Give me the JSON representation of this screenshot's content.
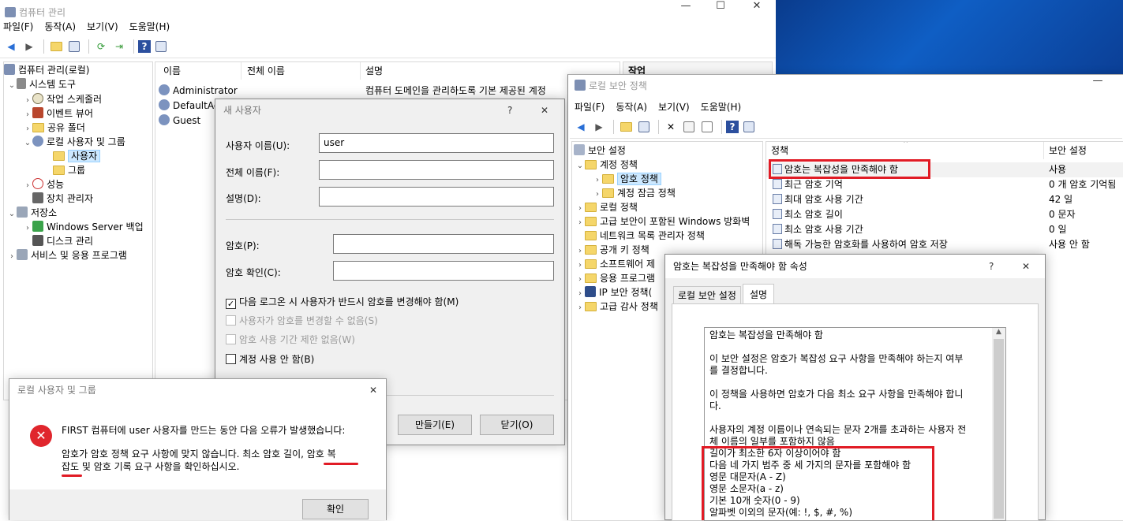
{
  "compmgmt": {
    "title": "컴퓨터 관리",
    "menu": [
      "파일(F)",
      "동작(A)",
      "보기(V)",
      "도움말(H)"
    ],
    "tree": [
      "컴퓨터 관리(로컬)",
      "시스템 도구",
      "작업 스케줄러",
      "이벤트 뷰어",
      "공유 폴더",
      "로컬 사용자 및 그룹",
      "사용자",
      "그룹",
      "성능",
      "장치 관리자",
      "저장소",
      "Windows Server 백업",
      "디스크 관리",
      "서비스 및 응용 프로그램"
    ],
    "columns": [
      "이름",
      "전체 이름",
      "설명"
    ],
    "users": [
      {
        "name": "Administrator",
        "desc": "컴퓨터 도메인을 관리하도록 기본 제공된 계정"
      },
      {
        "name": "DefaultAc",
        "desc": ""
      },
      {
        "name": "Guest",
        "desc": ""
      }
    ],
    "actions_header": "작업"
  },
  "newuser": {
    "title": "새 사용자",
    "help": "?",
    "close": "✕",
    "username_label": "사용자 이름(U):",
    "username_value": "user",
    "fullname_label": "전체 이름(F):",
    "fullname_value": "",
    "desc_label": "설명(D):",
    "desc_value": "",
    "password_label": "암호(P):",
    "confirm_label": "암호 확인(C):",
    "chk_must_change": "다음 로그온 시 사용자가 반드시 암호를 변경해야 함(M)",
    "chk_cannot_change": "사용자가 암호를 변경할 수 없음(S)",
    "chk_never_expires": "암호 사용 기간 제한 없음(W)",
    "chk_disabled": "계정 사용 안 함(B)",
    "create_button": "만들기(E)",
    "close_button": "닫기(O)"
  },
  "errordlg": {
    "title": "로컬 사용자 및 그룹",
    "close": "✕",
    "line1": "FIRST 컴퓨터에 user 사용자를 만드는 동안 다음 오류가 발생했습니다:",
    "line2": "암호가 암호 정책 요구 사항에 맞지 않습니다. 최소 암호 길이, 암호 복",
    "line3": "잡도 및 암호 기록 요구 사항을 확인하십시오.",
    "ok_button": "확인"
  },
  "secpol": {
    "title": "로컬 보안 정책",
    "menu": [
      "파일(F)",
      "동작(A)",
      "보기(V)",
      "도움말(H)"
    ],
    "tree": [
      "보안 설정",
      "계정 정책",
      "암호 정책",
      "계정 잠금 정책",
      "로컬 정책",
      "고급 보안이 포함된 Windows 방화벽",
      "네트워크 목록 관리자 정책",
      "공개 키 정책",
      "소프트웨어 제",
      "응용 프로그램",
      "IP 보안 정책(",
      "고급 감사 정책"
    ],
    "columns": [
      "정책",
      "보안 설정"
    ],
    "policies": [
      {
        "name": "암호는 복잡성을 만족해야 함",
        "value": "사용"
      },
      {
        "name": "최근 암호 기억",
        "value": "0 개 암호 기억됨"
      },
      {
        "name": "최대 암호 사용 기간",
        "value": "42 일"
      },
      {
        "name": "최소 암호 길이",
        "value": "0 문자"
      },
      {
        "name": "최소 암호 사용 기간",
        "value": "0 일"
      },
      {
        "name": "해독 가능한 암호화를 사용하여 암호 저장",
        "value": "사용 안 함"
      }
    ]
  },
  "propdlg": {
    "title": "암호는 복잡성을 만족해야 함 속성",
    "help": "?",
    "close": "✕",
    "tabs": [
      "로컬 보안 설정",
      "설명"
    ],
    "text": [
      "암호는 복잡성을 만족해야 함",
      "",
      "이 보안 설정은 암호가 복잡성 요구 사항을 만족해야 하는지 여부",
      "를 결정합니다.",
      "",
      "이 정책을 사용하면 암호가 다음 최소 요구 사항을 만족해야 합니",
      "다.",
      "",
      "사용자의 계정 이름이나 연속되는 문자 2개를 초과하는 사용자 전",
      "체 이름의 일부를 포함하지 않음",
      "길이가 최소한 6자 이상이어야 함",
      "다음 네 가지 범주 중 세 가지의 문자를 포함해야 함",
      "영문 대문자(A - Z)",
      "영문 소문자(a - z)",
      "기본 10개 숫자(0 - 9)",
      "알파벳 이외의 문자(예: !, $, #, %)"
    ]
  },
  "colors": {
    "highlight": "#e11b25",
    "selection": "#cce8ff"
  }
}
